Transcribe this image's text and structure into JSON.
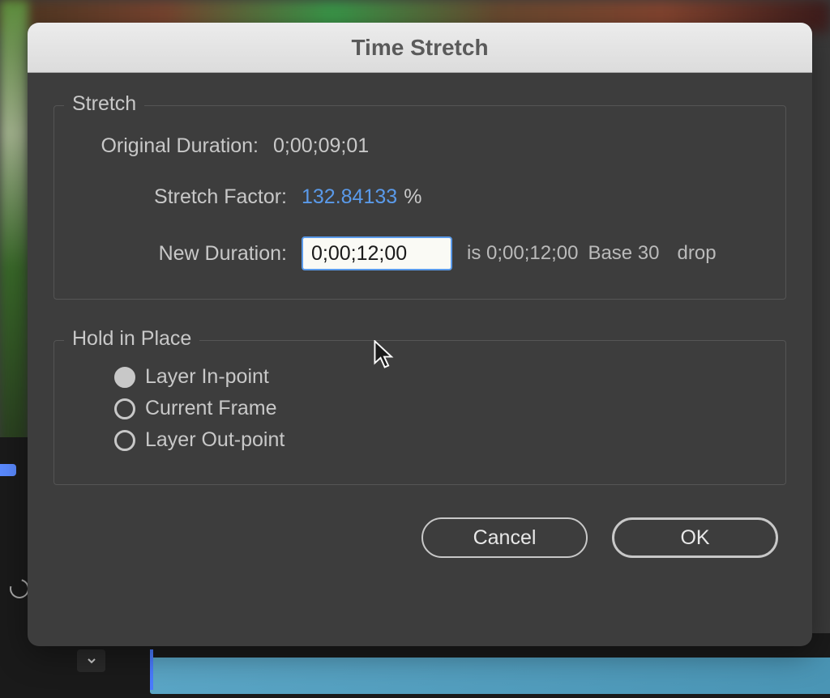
{
  "dialog": {
    "title": "Time Stretch",
    "stretch": {
      "legend": "Stretch",
      "original_duration_label": "Original Duration:",
      "original_duration_value": "0;00;09;01",
      "stretch_factor_label": "Stretch Factor:",
      "stretch_factor_value": "132.84133",
      "stretch_factor_unit": "%",
      "new_duration_label": "New Duration:",
      "new_duration_value": "0;00;12;00",
      "new_duration_is": "is 0;00;12;00",
      "new_duration_base": "Base 30",
      "new_duration_drop": "drop"
    },
    "hold": {
      "legend": "Hold in Place",
      "options": [
        {
          "label": "Layer In-point",
          "selected": true
        },
        {
          "label": "Current Frame",
          "selected": false
        },
        {
          "label": "Layer Out-point",
          "selected": false
        }
      ]
    },
    "buttons": {
      "cancel": "Cancel",
      "ok": "OK"
    }
  }
}
